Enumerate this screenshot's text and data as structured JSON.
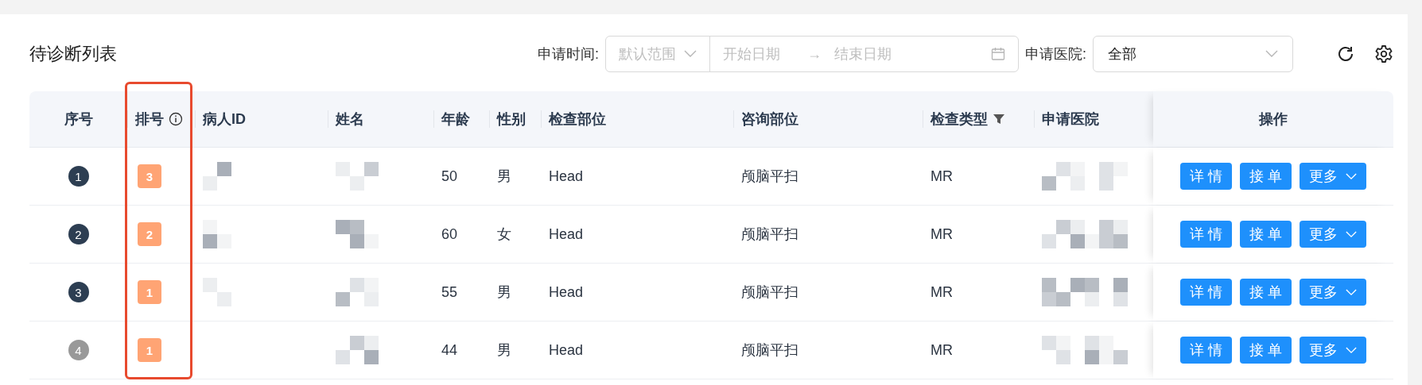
{
  "title": "待诊断列表",
  "filters": {
    "time_label": "申请时间:",
    "range_preset": {
      "placeholder": "默认范围"
    },
    "start_date": {
      "placeholder": "开始日期"
    },
    "range_arrow": "→",
    "end_date": {
      "placeholder": "结束日期"
    },
    "hospital_label": "申请医院:",
    "hospital_select": {
      "value": "全部"
    }
  },
  "table": {
    "columns": [
      {
        "label": "序号"
      },
      {
        "label": "排号",
        "info": true,
        "highlighted": true
      },
      {
        "label": "病人ID"
      },
      {
        "label": "姓名"
      },
      {
        "label": "年龄"
      },
      {
        "label": "性别"
      },
      {
        "label": "检查部位"
      },
      {
        "label": "咨询部位"
      },
      {
        "label": "检查类型",
        "filter": true
      },
      {
        "label": "申请医院"
      },
      {
        "label": "操作"
      }
    ],
    "rows": [
      {
        "index": "1",
        "color": "#2d3e52",
        "rank": "3",
        "patient_id_masked": true,
        "name_masked": true,
        "age": "50",
        "sex": "男",
        "exam_part": "Head",
        "consult_part": "颅脑平扫",
        "exam_type": "MR",
        "hospital_masked": true,
        "actions": [
          "详 情",
          "接 单",
          "更多"
        ]
      },
      {
        "index": "2",
        "color": "#2d3e52",
        "rank": "2",
        "patient_id_masked": true,
        "name_masked": true,
        "age": "60",
        "sex": "女",
        "exam_part": "Head",
        "consult_part": "颅脑平扫",
        "exam_type": "MR",
        "hospital_masked": true,
        "actions": [
          "详 情",
          "接 单",
          "更多"
        ]
      },
      {
        "index": "3",
        "color": "#2d3e52",
        "rank": "1",
        "patient_id_masked": true,
        "name_masked": true,
        "age": "55",
        "sex": "男",
        "exam_part": "Head",
        "consult_part": "颅脑平扫",
        "exam_type": "MR",
        "hospital_masked": true,
        "actions": [
          "详 情",
          "接 单",
          "更多"
        ]
      },
      {
        "index": "4",
        "color": "#999999",
        "rank": "1",
        "patient_id_masked": false,
        "name_masked": true,
        "age": "44",
        "sex": "男",
        "exam_part": "Head",
        "consult_part": "颅脑平扫",
        "exam_type": "MR",
        "hospital_masked": true,
        "actions": [
          "详 情",
          "接 单",
          "更多"
        ]
      }
    ]
  }
}
